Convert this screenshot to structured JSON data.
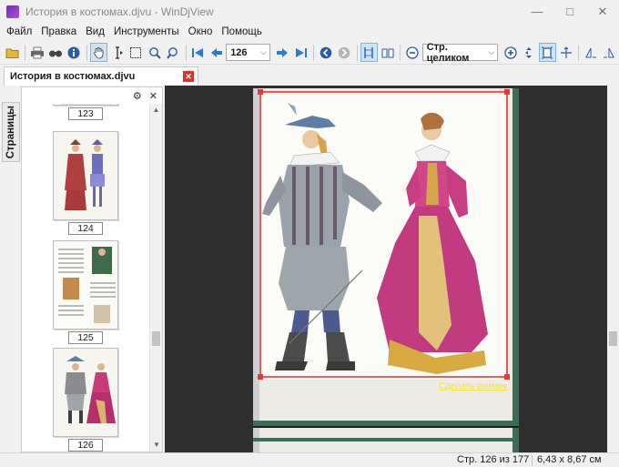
{
  "window": {
    "title": "История в костюмах.djvu - WinDjView"
  },
  "menu": [
    "Файл",
    "Правка",
    "Вид",
    "Инструменты",
    "Окно",
    "Помощь"
  ],
  "toolbar": {
    "page_value": "126",
    "zoom_value": "Стр. целиком",
    "icons": [
      "open-icon",
      "print-icon",
      "find-icon",
      "info-icon",
      "hand-tool-icon",
      "select-text-icon",
      "select-rect-icon",
      "zoom-in-tool-icon",
      "zoom-rect-icon",
      "first-page-icon",
      "prev-page-icon",
      "next-page-icon",
      "last-page-icon",
      "back-icon",
      "forward-icon",
      "single-page-icon",
      "two-page-icon",
      "zoom-out-icon",
      "zoom-in-icon",
      "fit-width-icon",
      "fit-page-icon",
      "rotate-left-icon",
      "rotate-right-icon"
    ]
  },
  "tab": {
    "label": "История в костюмах.djvu"
  },
  "sidebar": {
    "tab_label": "Страницы"
  },
  "thumbnails": [
    {
      "num": "123"
    },
    {
      "num": "124"
    },
    {
      "num": "125"
    },
    {
      "num": "126"
    }
  ],
  "viewer": {
    "selection_label": "314x361",
    "snapshot_link": "Сделать снимок"
  },
  "status": {
    "page": "Стр. 126 из 177",
    "size": "6,43 x 8,67 см"
  },
  "colors": {
    "selection": "#e53935",
    "label": "#f5e33a"
  }
}
